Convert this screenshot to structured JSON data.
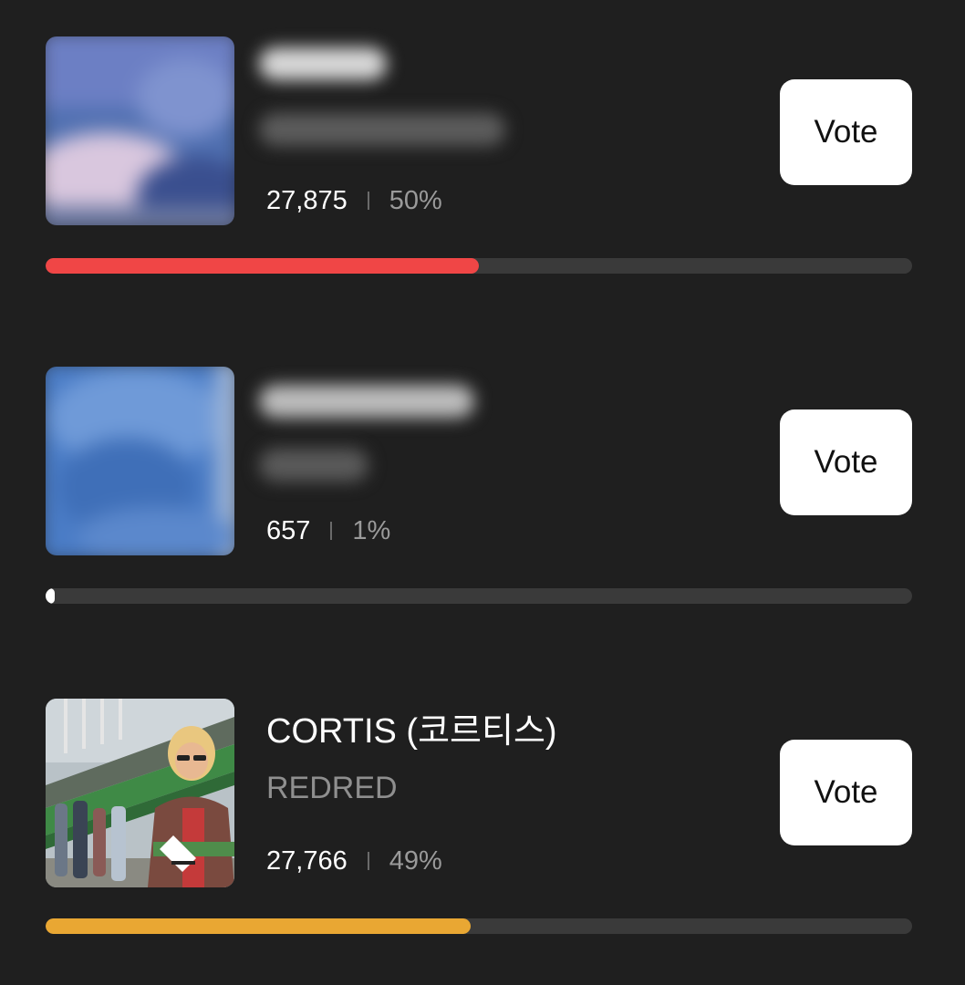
{
  "entries": [
    {
      "title": "",
      "subtitle": "",
      "votes": "27,875",
      "percent": "50%",
      "fill_fraction": 0.5,
      "bar_color": "#f04646",
      "vote_label": "Vote",
      "obscured": true
    },
    {
      "title": "",
      "subtitle": "",
      "votes": "657",
      "percent": "1%",
      "fill_fraction": 0.01,
      "bar_color": "#ffffff",
      "vote_label": "Vote",
      "obscured": true
    },
    {
      "title": "CORTIS (코르티스)",
      "subtitle": "REDRED",
      "votes": "27,766",
      "percent": "49%",
      "fill_fraction": 0.49,
      "bar_color": "#e9a733",
      "vote_label": "Vote",
      "obscured": false
    }
  ],
  "colors": {
    "background": "#1f1f1f",
    "track": "#3a3a3a",
    "button_bg": "#ffffff",
    "button_text": "#111111"
  }
}
